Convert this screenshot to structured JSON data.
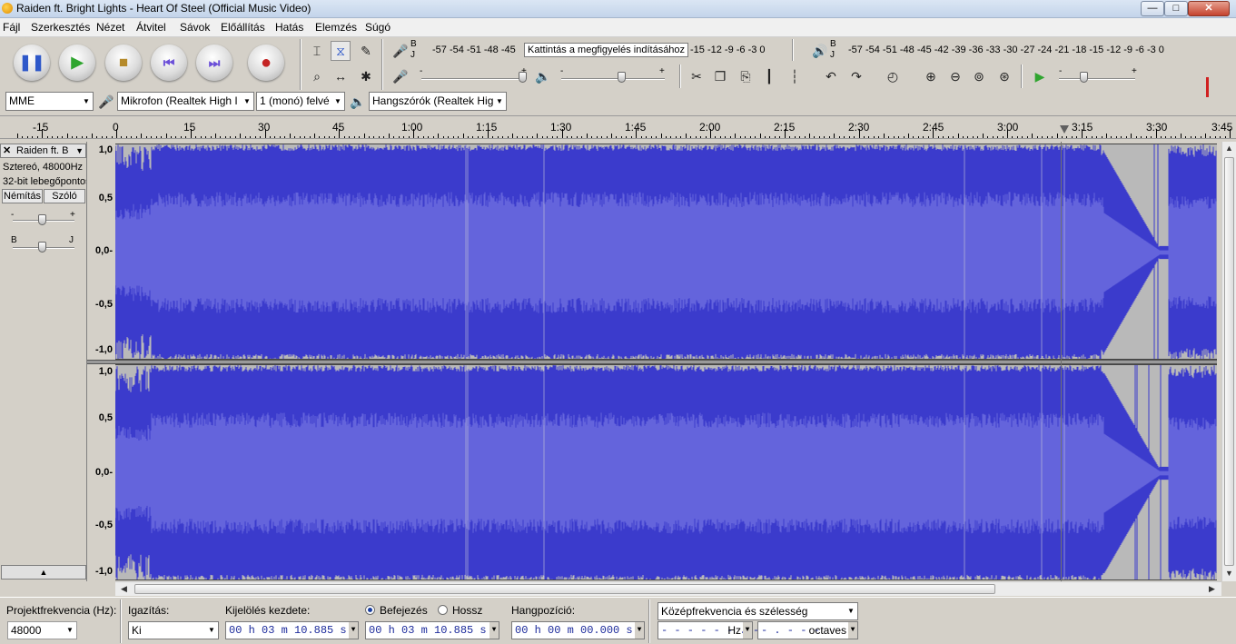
{
  "window": {
    "title": "Raiden ft. Bright Lights - Heart Of Steel (Official Music Video)",
    "buttons": {
      "minimize": "—",
      "maximize": "□",
      "close": "✕"
    }
  },
  "menu": [
    "Fájl",
    "Szerkesztés",
    "Nézet",
    "Átvitel",
    "Sávok",
    "Előállítás",
    "Hatás",
    "Elemzés",
    "Súgó"
  ],
  "transport": {
    "pause": "pause-icon",
    "play": "play-icon",
    "stop": "stop-icon",
    "skip_start": "skip-to-start-icon",
    "skip_end": "skip-to-end-icon",
    "record": "record-icon",
    "colors": {
      "play": "#2fa52f",
      "skip": "#6b4fd8",
      "record": "#c42424",
      "pause": "#2e58c9",
      "stop": "#b58a2a"
    }
  },
  "meters": {
    "record_ticks": "-57 -54 -51 -48 -45",
    "record_ticks_right": "-15 -12 -9 -6 -3 0",
    "record_prompt": "Kattintás a megfigyelés indításához",
    "playback_ticks": "-57 -54 -51 -48 -45 -42 -39 -36 -33 -30 -27 -24 -21 -18 -15 -12 -9 -6 -3 0",
    "channel_labels": {
      "left": "B",
      "right": "J"
    }
  },
  "mixer": {
    "minus": "-",
    "plus": "+"
  },
  "device": {
    "host": "MME",
    "input": "Mikrofon (Realtek High I",
    "channels": "1 (monó) felvé",
    "output": "Hangszórók (Realtek Hig"
  },
  "ruler": {
    "labels": [
      "-15",
      "0",
      "15",
      "30",
      "45",
      "1:00",
      "1:15",
      "1:30",
      "1:45",
      "2:00",
      "2:15",
      "2:30",
      "2:45",
      "3:00",
      "3:15",
      "3:30",
      "3:45"
    ]
  },
  "track": {
    "name": "Raiden ft. B",
    "format": "Sztereó, 48000Hz",
    "bitdepth": "32-bit lebegőpontos",
    "mute": "Némítás",
    "solo": "Szóló",
    "gain_minus": "-",
    "gain_plus": "+",
    "pan_left": "B",
    "pan_right": "J",
    "collapse": "▲",
    "scale": [
      "1,0",
      "0,5",
      "0,0-",
      "-0,5",
      "-1,0"
    ],
    "wave_color": "#3b3bcc",
    "rms_color": "#6464dc"
  },
  "bottom": {
    "rate_label": "Projektfrekvencia (Hz):",
    "rate_value": "48000",
    "snap_label": "Igazítás:",
    "snap_value": "Ki",
    "sel_start_label": "Kijelölés kezdete:",
    "sel_start_value": "00 h 03 m 10.885 s",
    "end_label": "Befejezés",
    "length_label": "Hossz",
    "sel_end_value": "00 h 03 m 10.885 s",
    "pos_label": "Hangpozíció:",
    "pos_value": "00 h 00 m 00.000 s",
    "spectral_mode": "Középfrekvencia és szélesség",
    "freq_value": "- - - - - - . - -",
    "freq_unit": "Hz",
    "width_value": "- . - - -",
    "width_unit": "octaves"
  }
}
